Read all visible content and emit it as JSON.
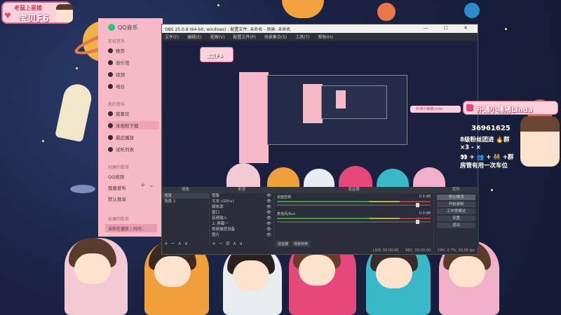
{
  "streamer_badge": {
    "subtitle": "老鼠上星槎",
    "name": "宝贝F6"
  },
  "qq_music": {
    "title": "QQ音乐",
    "section_online": "在线音乐",
    "online_items": [
      "推荐",
      "音乐馆",
      "视频",
      "电台"
    ],
    "section_mine": "我的音乐",
    "mine_items": [
      "我喜欢",
      "本地和下载",
      "最近播放",
      "试听列表"
    ],
    "section_created": "创建的歌单",
    "created_items": [
      "QQ视频",
      "我喜爱听",
      "默认歌单"
    ],
    "section_collected": "收藏的歌单",
    "bottom_item": "当前在播放 | 时间..."
  },
  "obs": {
    "title": "OBS 25.0.8 (64-bit, windows) - 配置文件: 未命名 - 场景: 未命名",
    "menu": [
      "文件(F)",
      "编辑(E)",
      "视图(V)",
      "配置文件(P)",
      "场景集合(S)",
      "工具(T)",
      "帮助(H)"
    ],
    "preview_badge": "宝贝F6",
    "preview_tag": "扑通小猪猪Linda",
    "scenes_header": "场景",
    "scenes": [
      "场景",
      "场景 2"
    ],
    "sources_header": "来源",
    "sources": [
      "图像",
      "文本 (GDI+)",
      "媒体源",
      "窗口",
      "音频输入",
      "上 屏幕一",
      "视频捕获设备",
      "图片"
    ],
    "mixer_header": "混音器",
    "mixer_channels": [
      {
        "name": "桌面音频",
        "level": "0.0 dB"
      },
      {
        "name": "麦克风/Aux",
        "level": "0.0 dB"
      }
    ],
    "mixer_tabs": [
      "混音器",
      "场景转换"
    ],
    "controls_header": "控件",
    "controls": [
      "停止推流",
      "开始录制",
      "工作室模式",
      "设置",
      "退出"
    ],
    "status": {
      "live": "LIVE: 00:00:00",
      "rec": "REC: 00:00:00",
      "cpu": "CPU: 0.7%, 30.00 fps"
    }
  },
  "overlay": {
    "title": "扑通小猪猪Linda",
    "fans": "36961625",
    "fan_label": "8级粉丝团进 🔥群",
    "x_line": "×3 - ×",
    "plus_line": "👀 + 👥 + 🧑‍🤝‍🧑 +群",
    "bottom_line": "房管有用一次车位"
  }
}
